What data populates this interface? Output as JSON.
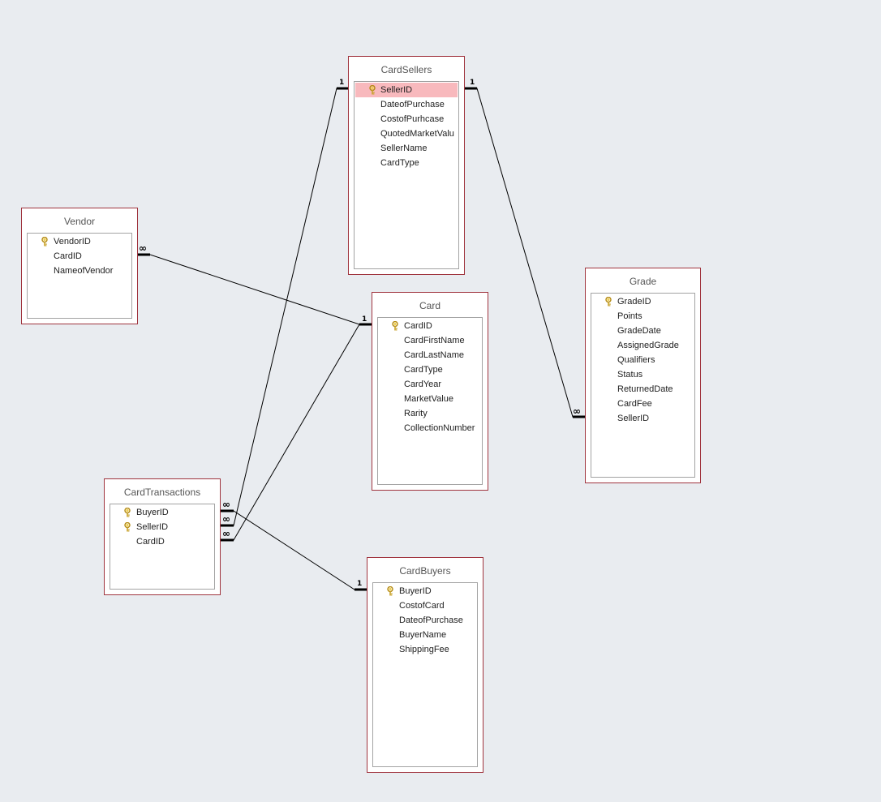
{
  "colors": {
    "background": "#e9ecf0",
    "table_border": "#a0343e",
    "selected_field": "#f8b9bd",
    "key": "#c8a22a"
  },
  "tables": {
    "cardsellers": {
      "title": "CardSellers",
      "fields": [
        {
          "name": "SellerID",
          "key": true,
          "selected": true
        },
        {
          "name": "DateofPurchase"
        },
        {
          "name": "CostofPurhcase"
        },
        {
          "name": "QuotedMarketValu"
        },
        {
          "name": "SellerName"
        },
        {
          "name": "CardType"
        }
      ]
    },
    "vendor": {
      "title": "Vendor",
      "fields": [
        {
          "name": "VendorID",
          "key": true
        },
        {
          "name": "CardID"
        },
        {
          "name": "NameofVendor"
        }
      ]
    },
    "card": {
      "title": "Card",
      "fields": [
        {
          "name": "CardID",
          "key": true
        },
        {
          "name": "CardFirstName"
        },
        {
          "name": "CardLastName"
        },
        {
          "name": "CardType"
        },
        {
          "name": "CardYear"
        },
        {
          "name": "MarketValue"
        },
        {
          "name": "Rarity"
        },
        {
          "name": "CollectionNumber"
        }
      ]
    },
    "grade": {
      "title": "Grade",
      "fields": [
        {
          "name": "GradeID",
          "key": true
        },
        {
          "name": "Points"
        },
        {
          "name": "GradeDate"
        },
        {
          "name": "AssignedGrade"
        },
        {
          "name": "Qualifiers"
        },
        {
          "name": "Status"
        },
        {
          "name": "ReturnedDate"
        },
        {
          "name": "CardFee"
        },
        {
          "name": "SellerID"
        }
      ]
    },
    "cardtransactions": {
      "title": "CardTransactions",
      "fields": [
        {
          "name": "BuyerID",
          "key": true
        },
        {
          "name": "SellerID",
          "key": true
        },
        {
          "name": "CardID"
        }
      ]
    },
    "cardbuyers": {
      "title": "CardBuyers",
      "fields": [
        {
          "name": "BuyerID",
          "key": true
        },
        {
          "name": "CostofCard"
        },
        {
          "name": "DateofPurchase"
        },
        {
          "name": "BuyerName"
        },
        {
          "name": "ShippingFee"
        }
      ]
    }
  },
  "relationships": [
    {
      "from": "CardSellers.SellerID",
      "to": "CardTransactions.SellerID",
      "one_label": "1",
      "many_label": "∞"
    },
    {
      "from": "CardSellers.SellerID",
      "to": "Grade.SellerID",
      "one_label": "1",
      "many_label": "∞"
    },
    {
      "from": "Card.CardID",
      "to": "Vendor.CardID",
      "one_label": "1",
      "many_label": "∞"
    },
    {
      "from": "Card.CardID",
      "to": "CardTransactions.CardID",
      "one_label": "1",
      "many_label": "∞"
    },
    {
      "from": "CardBuyers.BuyerID",
      "to": "CardTransactions.BuyerID",
      "one_label": "1",
      "many_label": "∞"
    }
  ]
}
